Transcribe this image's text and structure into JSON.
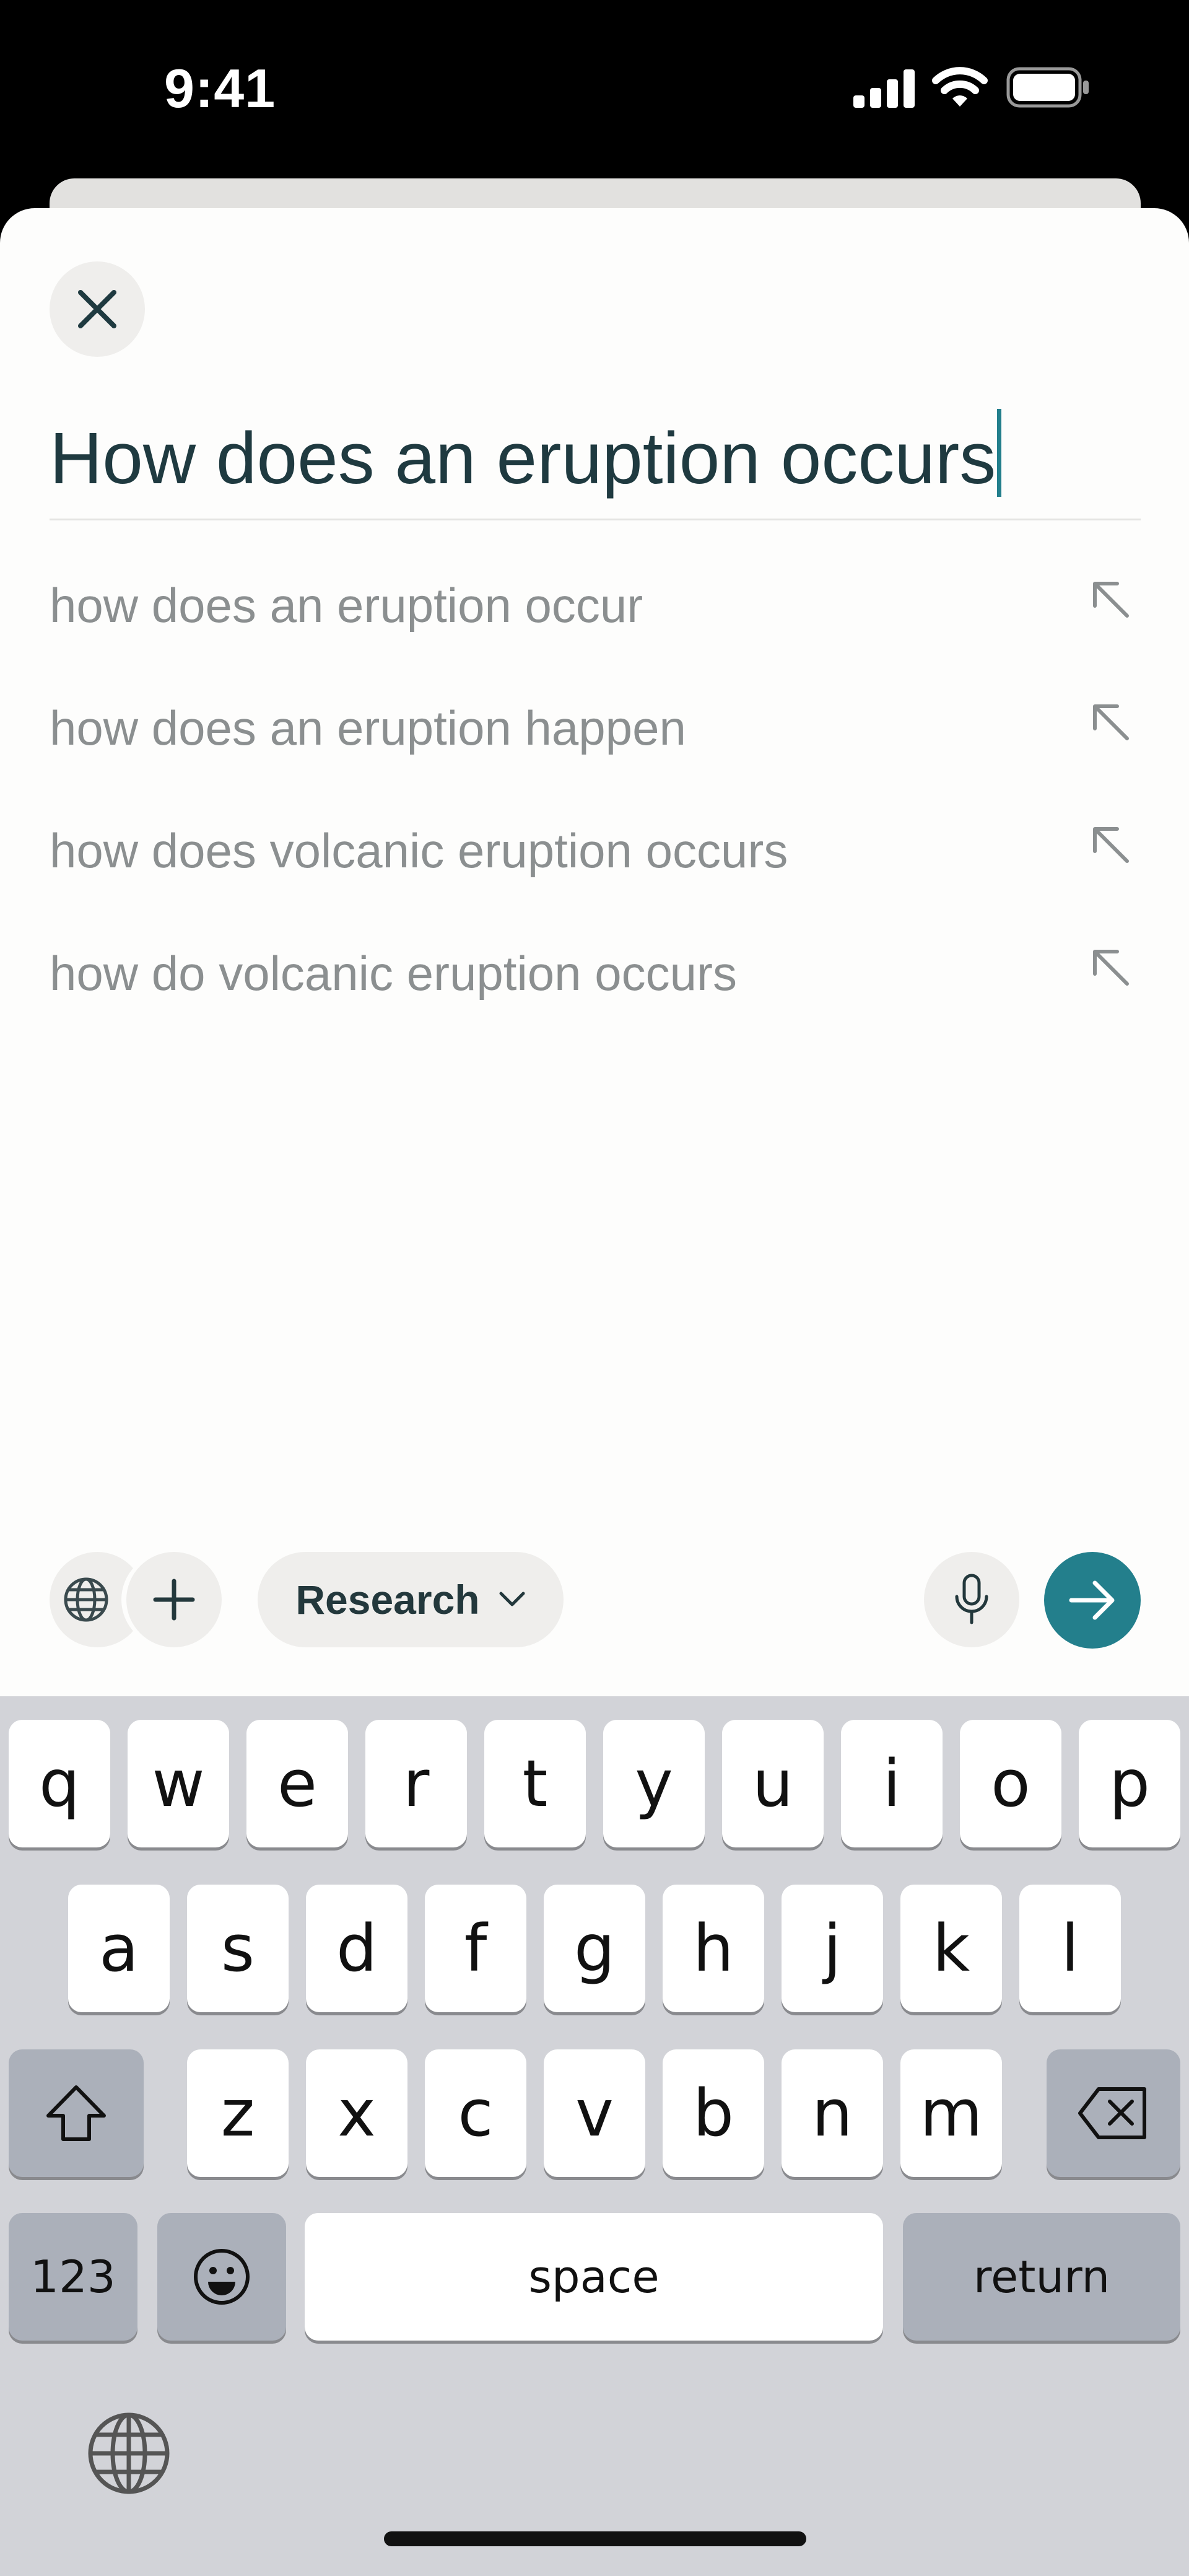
{
  "status_bar": {
    "time": "9:41"
  },
  "search": {
    "query": "How does an eruption occurs",
    "suggestions": [
      {
        "text": "how does an eruption occur"
      },
      {
        "text": "how does an eruption happen"
      },
      {
        "text": "how does volcanic eruption occurs"
      },
      {
        "text": "how do volcanic eruption occurs"
      }
    ]
  },
  "toolbar": {
    "mode_label": "Research",
    "icons": [
      "globe-icon",
      "plus-icon",
      "chevron-down-icon",
      "microphone-icon",
      "arrow-right-icon"
    ]
  },
  "keyboard": {
    "row1": [
      "q",
      "w",
      "e",
      "r",
      "t",
      "y",
      "u",
      "i",
      "o",
      "p"
    ],
    "row2": [
      "a",
      "s",
      "d",
      "f",
      "g",
      "h",
      "j",
      "k",
      "l"
    ],
    "row3": [
      "z",
      "x",
      "c",
      "v",
      "b",
      "n",
      "m"
    ],
    "numbers_label": "123",
    "space_label": "space",
    "return_label": "return"
  },
  "colors": {
    "accent": "#237f8c",
    "query_text": "#1f3a40",
    "suggestion_text": "#8b8f90",
    "keyboard_bg": "#d2d3d8"
  }
}
